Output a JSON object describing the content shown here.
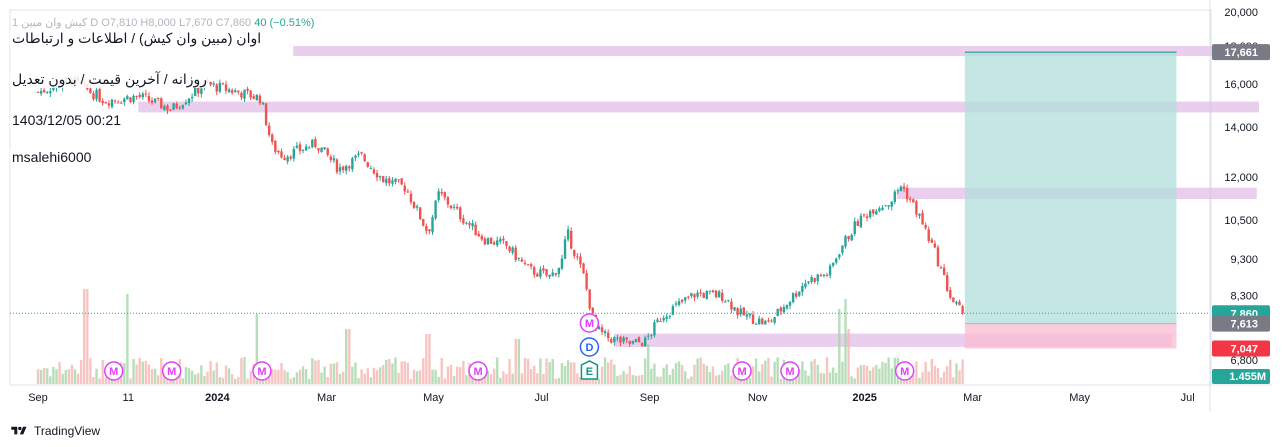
{
  "header": {
    "ohlc_faded": "1 کیش وان مبین D  O7,810  H8,000  L7,670  C7,860",
    "change": "40 (−0.51%)"
  },
  "overlay": {
    "symbol_line": "اوان (مبین وان کیش) / اطلاعات و ارتباطات",
    "timeframe_line": "روزانه / آخرین قیمت / بدون تعدیل",
    "datetime": "1403/12/05 00:21",
    "author": "msalehi6000"
  },
  "footer": {
    "brand": "TradingView"
  },
  "colors": {
    "up": "#26a69a",
    "down": "#ef5350",
    "zone": "#e1bee7",
    "target_fill": "#b2dfdb",
    "stop_fill": "#f8bbd0",
    "badge_last": "#26a69a",
    "badge_stop": "#f23645",
    "badge_entry": "#787b86",
    "marker": "#e040fb",
    "dividend": "#2962ff",
    "earnings": "#089981"
  },
  "chart_data": {
    "type": "candlestick",
    "scale": "log",
    "ylim": [
      6800,
      20000
    ],
    "y_ticks": [
      {
        "value": 20000,
        "label": "20,000"
      },
      {
        "value": 18000,
        "label": "18,000"
      },
      {
        "value": 16000,
        "label": "16,000"
      },
      {
        "value": 14000,
        "label": "14,000"
      },
      {
        "value": 12000,
        "label": "12,000"
      },
      {
        "value": 10500,
        "label": "10,500"
      },
      {
        "value": 9300,
        "label": "9,300"
      },
      {
        "value": 8300,
        "label": "8,300"
      },
      {
        "value": 6800,
        "label": "6,800"
      }
    ],
    "x_labels": [
      {
        "t": 0.0,
        "label": "Sep",
        "bold": false
      },
      {
        "t": 0.081,
        "label": "11",
        "bold": false
      },
      {
        "t": 0.161,
        "label": "2024",
        "bold": true
      },
      {
        "t": 0.259,
        "label": "Mar",
        "bold": false
      },
      {
        "t": 0.355,
        "label": "May",
        "bold": false
      },
      {
        "t": 0.452,
        "label": "Jul",
        "bold": false
      },
      {
        "t": 0.549,
        "label": "Sep",
        "bold": false
      },
      {
        "t": 0.646,
        "label": "Nov",
        "bold": false
      },
      {
        "t": 0.742,
        "label": "2025",
        "bold": true
      },
      {
        "t": 0.839,
        "label": "Mar",
        "bold": false
      },
      {
        "t": 0.935,
        "label": "May",
        "bold": false
      },
      {
        "t": 1.032,
        "label": "Jul",
        "bold": false
      }
    ],
    "path_keypoints": [
      [
        0.0,
        15600
      ],
      [
        0.03,
        16200
      ],
      [
        0.06,
        15200
      ],
      [
        0.09,
        15400
      ],
      [
        0.12,
        14800
      ],
      [
        0.15,
        16000
      ],
      [
        0.18,
        15600
      ],
      [
        0.2,
        15300
      ],
      [
        0.21,
        13200
      ],
      [
        0.22,
        12800
      ],
      [
        0.25,
        13300
      ],
      [
        0.27,
        12300
      ],
      [
        0.29,
        12800
      ],
      [
        0.31,
        11900
      ],
      [
        0.33,
        11600
      ],
      [
        0.35,
        10100
      ],
      [
        0.36,
        11400
      ],
      [
        0.38,
        10600
      ],
      [
        0.4,
        9900
      ],
      [
        0.42,
        9700
      ],
      [
        0.44,
        9000
      ],
      [
        0.46,
        8800
      ],
      [
        0.47,
        9200
      ],
      [
        0.475,
        10100
      ],
      [
        0.49,
        8800
      ],
      [
        0.5,
        7500
      ],
      [
        0.51,
        7300
      ],
      [
        0.53,
        7150
      ],
      [
        0.545,
        7200
      ],
      [
        0.56,
        7800
      ],
      [
        0.59,
        8350
      ],
      [
        0.615,
        8300
      ],
      [
        0.63,
        7850
      ],
      [
        0.645,
        7700
      ],
      [
        0.655,
        7600
      ],
      [
        0.67,
        8050
      ],
      [
        0.69,
        8700
      ],
      [
        0.71,
        8900
      ],
      [
        0.72,
        9600
      ],
      [
        0.735,
        10400
      ],
      [
        0.75,
        10900
      ],
      [
        0.765,
        11100
      ],
      [
        0.775,
        11700
      ],
      [
        0.79,
        10700
      ],
      [
        0.805,
        9500
      ],
      [
        0.82,
        8200
      ],
      [
        0.83,
        7860
      ]
    ],
    "last_price": 7860,
    "zones": [
      {
        "y1": 17450,
        "y2": 18000,
        "t1": 0.229,
        "t2": 1.087
      },
      {
        "y1": 14650,
        "y2": 15150,
        "t1": 0.09,
        "t2": 1.096
      },
      {
        "y1": 11200,
        "y2": 11600,
        "t1": 0.771,
        "t2": 1.094
      },
      {
        "y1": 7080,
        "y2": 7380,
        "t1": 0.517,
        "t2": 1.018
      }
    ],
    "position": {
      "t1": 0.832,
      "t2": 1.022,
      "target": 17661,
      "entry": 7613,
      "stop": 7047
    },
    "price_badges": [
      {
        "value": 17661,
        "label": "17,661",
        "kind": "entry"
      },
      {
        "value": 7860,
        "label": "7,860",
        "kind": "last"
      },
      {
        "value": 7613,
        "label": "7,613",
        "kind": "entry"
      },
      {
        "value": 7047,
        "label": "7,047",
        "kind": "stop"
      }
    ],
    "volume": {
      "max_label": "1.455M",
      "spikes": [
        {
          "t": 0.043,
          "h": 0.95
        },
        {
          "t": 0.08,
          "h": 0.9
        },
        {
          "t": 0.196,
          "h": 0.7
        },
        {
          "t": 0.278,
          "h": 0.55
        },
        {
          "t": 0.35,
          "h": 0.5
        },
        {
          "t": 0.43,
          "h": 0.45
        },
        {
          "t": 0.548,
          "h": 0.4
        },
        {
          "t": 0.72,
          "h": 0.75
        },
        {
          "t": 0.725,
          "h": 0.85
        },
        {
          "t": 0.728,
          "h": 0.55
        }
      ]
    },
    "event_markers": [
      {
        "t": 0.068,
        "letter": "M",
        "row": "bottom",
        "kind": "marker"
      },
      {
        "t": 0.12,
        "letter": "M",
        "row": "bottom",
        "kind": "marker"
      },
      {
        "t": 0.201,
        "letter": "M",
        "row": "bottom",
        "kind": "marker"
      },
      {
        "t": 0.395,
        "letter": "M",
        "row": "bottom",
        "kind": "marker"
      },
      {
        "t": 0.495,
        "letter": "E",
        "row": "bottom",
        "kind": "earnings"
      },
      {
        "t": 0.495,
        "letter": "D",
        "row": "middle",
        "kind": "dividend"
      },
      {
        "t": 0.495,
        "letter": "M",
        "row": "top",
        "kind": "marker"
      },
      {
        "t": 0.632,
        "letter": "M",
        "row": "bottom",
        "kind": "marker"
      },
      {
        "t": 0.675,
        "letter": "M",
        "row": "bottom",
        "kind": "marker"
      },
      {
        "t": 0.778,
        "letter": "M",
        "row": "bottom",
        "kind": "marker"
      }
    ]
  }
}
